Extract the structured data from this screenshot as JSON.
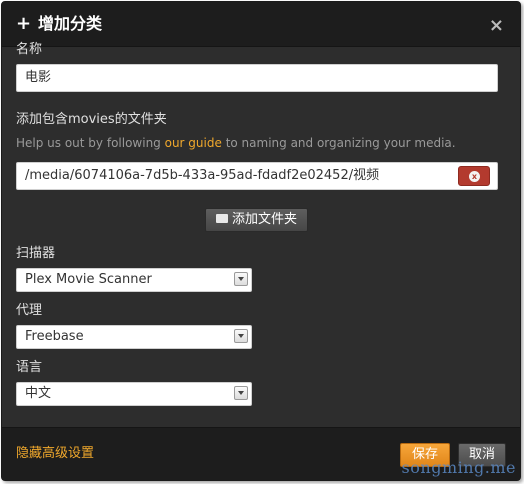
{
  "dialog": {
    "title_icon": "plus-icon",
    "title_plus": "+",
    "title": "增加分类",
    "close_icon": "×"
  },
  "name": {
    "label": "名称",
    "value": "电影"
  },
  "folders": {
    "label": "添加包含movies的文件夹",
    "help_prefix": "Help us out by following ",
    "help_link": "our guide",
    "help_suffix": " to naming and organizing your media.",
    "path": "/media/6074106a-7d5b-433a-95ad-fdadf2e02452/视频",
    "remove_icon": "x",
    "add_button_label": "添加文件夹"
  },
  "scanner": {
    "label": "扫描器",
    "selected": "Plex Movie Scanner"
  },
  "agent": {
    "label": "代理",
    "selected": "Freebase"
  },
  "language": {
    "label": "语言",
    "selected": "中文"
  },
  "footer": {
    "advanced_link": "隐藏高级设置",
    "save_label": "保存",
    "cancel_label": "取消"
  },
  "watermark": "songming.me",
  "colors": {
    "accent": "#f0a82c",
    "remove": "#b33a2e",
    "dialog_bg": "#2d2d2d",
    "titlebar_bg": "#1d1d1d"
  }
}
